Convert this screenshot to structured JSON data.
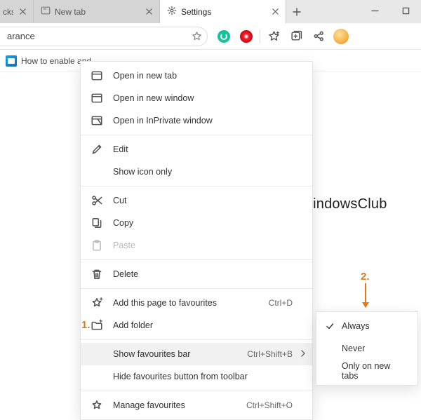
{
  "tabs": {
    "truncated_label": "cks, H",
    "middle_label": "New tab",
    "active_label": "Settings"
  },
  "address_text": "arance",
  "favbar_item": "How to enable and...",
  "watermark": "TheWindowsClub",
  "callouts": {
    "one": "1.",
    "two": "2."
  },
  "ctx": {
    "open_new_tab": "Open in new tab",
    "open_new_window": "Open in new window",
    "open_inprivate": "Open in InPrivate window",
    "edit": "Edit",
    "show_icon_only": "Show icon only",
    "cut": "Cut",
    "copy": "Copy",
    "paste": "Paste",
    "delete": "Delete",
    "add_page_fav": "Add this page to favourites",
    "add_page_fav_sc": "Ctrl+D",
    "add_folder": "Add folder",
    "show_fav_bar": "Show favourites bar",
    "show_fav_bar_sc": "Ctrl+Shift+B",
    "hide_fav_btn": "Hide favourites button from toolbar",
    "manage_fav": "Manage favourites",
    "manage_fav_sc": "Ctrl+Shift+O"
  },
  "submenu": {
    "always": "Always",
    "never": "Never",
    "only_new": "Only on new tabs"
  }
}
